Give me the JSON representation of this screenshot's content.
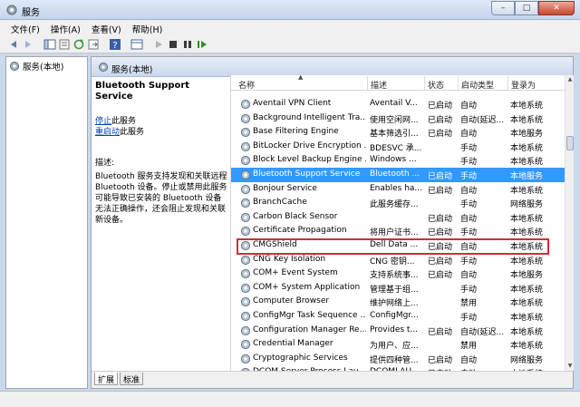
{
  "window": {
    "title": "服务",
    "buttons": {
      "minimize": "–",
      "maximize": "□",
      "close": "✕"
    }
  },
  "menu": [
    "文件(F)",
    "操作(A)",
    "查看(V)",
    "帮助(H)"
  ],
  "tree": {
    "root_label": "服务(本地)"
  },
  "header": {
    "title": "服务(本地)"
  },
  "details": {
    "service_name": "Bluetooth Support Service",
    "action_stop_link": "停止",
    "action_stop_suffix": "此服务",
    "action_restart_link": "重启动",
    "action_restart_suffix": "此服务",
    "description_label": "描述:",
    "description_text": "Bluetooth 服务支持发现和关联远程 Bluetooth 设备。停止或禁用此服务可能导致已安装的 Bluetooth 设备无法正确操作，还会阻止发现和关联新设备。"
  },
  "columns": {
    "name": "名称",
    "description": "描述",
    "status": "状态",
    "startup": "启动类型",
    "logon": "登录为"
  },
  "services": [
    {
      "name": "Aventail VPN Client",
      "desc": "Aventail V...",
      "status": "已启动",
      "startup": "自动",
      "logon": "本地系统"
    },
    {
      "name": "Background Intelligent Tra...",
      "desc": "使用空闲网...",
      "status": "已启动",
      "startup": "自动(延迟...",
      "logon": "本地系统"
    },
    {
      "name": "Base Filtering Engine",
      "desc": "基本筛选引...",
      "status": "已启动",
      "startup": "自动",
      "logon": "本地服务"
    },
    {
      "name": "BitLocker Drive Encryption ...",
      "desc": "BDESVC 承...",
      "status": "",
      "startup": "手动",
      "logon": "本地系统"
    },
    {
      "name": "Block Level Backup Engine ...",
      "desc": "Windows ...",
      "status": "",
      "startup": "手动",
      "logon": "本地系统"
    },
    {
      "name": "Bluetooth Support Service",
      "desc": "Bluetooth ...",
      "status": "已启动",
      "startup": "手动",
      "logon": "本地服务"
    },
    {
      "name": "Bonjour Service",
      "desc": "Enables ha...",
      "status": "已启动",
      "startup": "自动",
      "logon": "本地系统"
    },
    {
      "name": "BranchCache",
      "desc": "此服务缓存...",
      "status": "",
      "startup": "手动",
      "logon": "网络服务"
    },
    {
      "name": "Carbon Black Sensor",
      "desc": "",
      "status": "已启动",
      "startup": "自动",
      "logon": "本地系统"
    },
    {
      "name": "Certificate Propagation",
      "desc": "将用户证书...",
      "status": "已启动",
      "startup": "手动",
      "logon": "本地系统"
    },
    {
      "name": "CMGShield",
      "desc": "Dell Data ...",
      "status": "已启动",
      "startup": "自动",
      "logon": "本地系统"
    },
    {
      "name": "CNG Key Isolation",
      "desc": "CNG 密钥...",
      "status": "已启动",
      "startup": "手动",
      "logon": "本地系统"
    },
    {
      "name": "COM+ Event System",
      "desc": "支持系统事...",
      "status": "已启动",
      "startup": "自动",
      "logon": "本地服务"
    },
    {
      "name": "COM+ System Application",
      "desc": "管理基于组...",
      "status": "",
      "startup": "手动",
      "logon": "本地系统"
    },
    {
      "name": "Computer Browser",
      "desc": "维护网络上...",
      "status": "",
      "startup": "禁用",
      "logon": "本地系统"
    },
    {
      "name": "ConfigMgr Task Sequence ...",
      "desc": "ConfigMgr...",
      "status": "",
      "startup": "手动",
      "logon": "本地系统"
    },
    {
      "name": "Configuration Manager Re...",
      "desc": "Provides t...",
      "status": "已启动",
      "startup": "自动(延迟...",
      "logon": "本地系统"
    },
    {
      "name": "Credential Manager",
      "desc": "为用户、应...",
      "status": "",
      "startup": "禁用",
      "logon": "本地系统"
    },
    {
      "name": "Cryptographic Services",
      "desc": "提供四种管...",
      "status": "已启动",
      "startup": "自动",
      "logon": "网络服务"
    },
    {
      "name": "DCOM Server Process Lau...",
      "desc": "DCOMLAU...",
      "status": "已启动",
      "startup": "自动",
      "logon": "本地系统"
    }
  ],
  "selected_index": 5,
  "tabs": [
    "扩展",
    "标准"
  ],
  "colors": {
    "selection": "#3399ff",
    "highlight_border": "#d22c3a",
    "link": "#0645ad"
  }
}
